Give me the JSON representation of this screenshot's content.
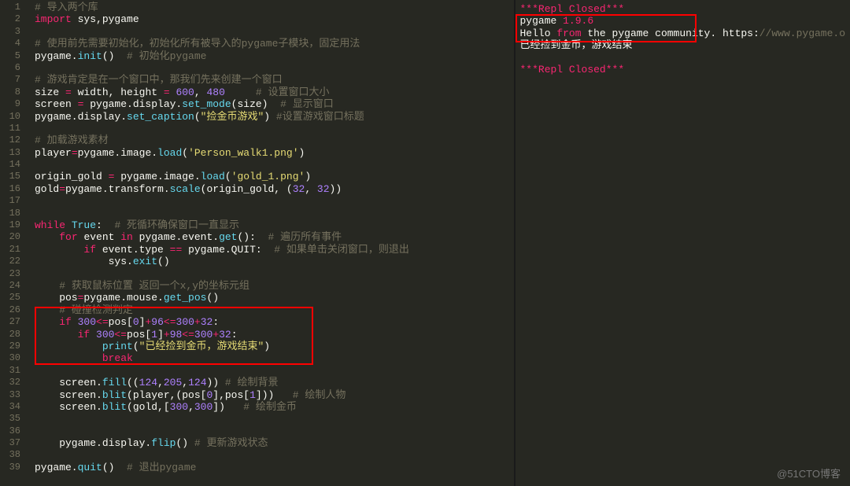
{
  "editor": {
    "lineStart": 1,
    "lineEnd": 39,
    "lines": [
      [
        {
          "t": "# 导入两个库",
          "cls": "c"
        }
      ],
      [
        {
          "t": "import ",
          "cls": "kw"
        },
        {
          "t": "sys,pygame",
          "cls": "nm"
        }
      ],
      [],
      [
        {
          "t": "# 使用前先需要初始化，初始化所有被导入的pygame子模块，固定用法",
          "cls": "c"
        }
      ],
      [
        {
          "t": "pygame.",
          "cls": "nm"
        },
        {
          "t": "init",
          "cls": "fn"
        },
        {
          "t": "()  ",
          "cls": "nm"
        },
        {
          "t": "# 初始化pygame",
          "cls": "c"
        }
      ],
      [],
      [
        {
          "t": "# 游戏肯定是在一个窗口中，那我们先来创建一个窗口",
          "cls": "c"
        }
      ],
      [
        {
          "t": "size ",
          "cls": "nm"
        },
        {
          "t": "= ",
          "cls": "op"
        },
        {
          "t": "width, height ",
          "cls": "nm"
        },
        {
          "t": "= ",
          "cls": "op"
        },
        {
          "t": "600",
          "cls": "nu"
        },
        {
          "t": ", ",
          "cls": "nm"
        },
        {
          "t": "480",
          "cls": "nu"
        },
        {
          "t": "     ",
          "cls": "nm"
        },
        {
          "t": "# 设置窗口大小",
          "cls": "c"
        }
      ],
      [
        {
          "t": "screen ",
          "cls": "nm"
        },
        {
          "t": "= ",
          "cls": "op"
        },
        {
          "t": "pygame.display.",
          "cls": "nm"
        },
        {
          "t": "set_mode",
          "cls": "fn"
        },
        {
          "t": "(size)  ",
          "cls": "nm"
        },
        {
          "t": "# 显示窗口",
          "cls": "c"
        }
      ],
      [
        {
          "t": "pygame.display.",
          "cls": "nm"
        },
        {
          "t": "set_caption",
          "cls": "fn"
        },
        {
          "t": "(",
          "cls": "nm"
        },
        {
          "t": "\"捡金币游戏\"",
          "cls": "st"
        },
        {
          "t": ") ",
          "cls": "nm"
        },
        {
          "t": "#设置游戏窗口标题",
          "cls": "c"
        }
      ],
      [],
      [
        {
          "t": "# 加载游戏素材",
          "cls": "c"
        }
      ],
      [
        {
          "t": "player",
          "cls": "nm"
        },
        {
          "t": "=",
          "cls": "op"
        },
        {
          "t": "pygame.image.",
          "cls": "nm"
        },
        {
          "t": "load",
          "cls": "fn"
        },
        {
          "t": "(",
          "cls": "nm"
        },
        {
          "t": "'Person_walk1.png'",
          "cls": "st"
        },
        {
          "t": ")",
          "cls": "nm"
        }
      ],
      [],
      [
        {
          "t": "origin_gold ",
          "cls": "nm"
        },
        {
          "t": "= ",
          "cls": "op"
        },
        {
          "t": "pygame.image.",
          "cls": "nm"
        },
        {
          "t": "load",
          "cls": "fn"
        },
        {
          "t": "(",
          "cls": "nm"
        },
        {
          "t": "'gold_1.png'",
          "cls": "st"
        },
        {
          "t": ")",
          "cls": "nm"
        }
      ],
      [
        {
          "t": "gold",
          "cls": "nm"
        },
        {
          "t": "=",
          "cls": "op"
        },
        {
          "t": "pygame.transform.",
          "cls": "nm"
        },
        {
          "t": "scale",
          "cls": "fn"
        },
        {
          "t": "(origin_gold, (",
          "cls": "nm"
        },
        {
          "t": "32",
          "cls": "nu"
        },
        {
          "t": ", ",
          "cls": "nm"
        },
        {
          "t": "32",
          "cls": "nu"
        },
        {
          "t": "))",
          "cls": "nm"
        }
      ],
      [],
      [],
      [
        {
          "t": "while ",
          "cls": "kw"
        },
        {
          "t": "True",
          "cls": "bi"
        },
        {
          "t": ":  ",
          "cls": "nm"
        },
        {
          "t": "# 死循环确保窗口一直显示",
          "cls": "c"
        }
      ],
      [
        {
          "t": "    ",
          "cls": "nm"
        },
        {
          "t": "for ",
          "cls": "kw"
        },
        {
          "t": "event ",
          "cls": "nm"
        },
        {
          "t": "in ",
          "cls": "kw"
        },
        {
          "t": "pygame.event.",
          "cls": "nm"
        },
        {
          "t": "get",
          "cls": "fn"
        },
        {
          "t": "():  ",
          "cls": "nm"
        },
        {
          "t": "# 遍历所有事件",
          "cls": "c"
        }
      ],
      [
        {
          "t": "        ",
          "cls": "nm"
        },
        {
          "t": "if ",
          "cls": "kw"
        },
        {
          "t": "event.type ",
          "cls": "nm"
        },
        {
          "t": "== ",
          "cls": "op"
        },
        {
          "t": "pygame.QUIT:  ",
          "cls": "nm"
        },
        {
          "t": "# 如果单击关闭窗口，则退出",
          "cls": "c"
        }
      ],
      [
        {
          "t": "            sys.",
          "cls": "nm"
        },
        {
          "t": "exit",
          "cls": "fn"
        },
        {
          "t": "()",
          "cls": "nm"
        }
      ],
      [],
      [
        {
          "t": "    ",
          "cls": "nm"
        },
        {
          "t": "# 获取鼠标位置 返回一个x,y的坐标元组",
          "cls": "c"
        }
      ],
      [
        {
          "t": "    pos",
          "cls": "nm"
        },
        {
          "t": "=",
          "cls": "op"
        },
        {
          "t": "pygame.mouse.",
          "cls": "nm"
        },
        {
          "t": "get_pos",
          "cls": "fn"
        },
        {
          "t": "()",
          "cls": "nm"
        }
      ],
      [
        {
          "t": "    ",
          "cls": "nm"
        },
        {
          "t": "# 碰撞检测判定",
          "cls": "c"
        }
      ],
      [
        {
          "t": "    ",
          "cls": "nm"
        },
        {
          "t": "if ",
          "cls": "kw"
        },
        {
          "t": "300",
          "cls": "nu"
        },
        {
          "t": "<=",
          "cls": "op"
        },
        {
          "t": "pos[",
          "cls": "nm"
        },
        {
          "t": "0",
          "cls": "nu"
        },
        {
          "t": "]",
          "cls": "nm"
        },
        {
          "t": "+",
          "cls": "op"
        },
        {
          "t": "96",
          "cls": "nu"
        },
        {
          "t": "<=",
          "cls": "op"
        },
        {
          "t": "300",
          "cls": "nu"
        },
        {
          "t": "+",
          "cls": "op"
        },
        {
          "t": "32",
          "cls": "nu"
        },
        {
          "t": ":",
          "cls": "nm"
        }
      ],
      [
        {
          "t": "       ",
          "cls": "nm"
        },
        {
          "t": "if ",
          "cls": "kw"
        },
        {
          "t": "300",
          "cls": "nu"
        },
        {
          "t": "<=",
          "cls": "op"
        },
        {
          "t": "pos[",
          "cls": "nm"
        },
        {
          "t": "1",
          "cls": "nu"
        },
        {
          "t": "]",
          "cls": "nm"
        },
        {
          "t": "+",
          "cls": "op"
        },
        {
          "t": "98",
          "cls": "nu"
        },
        {
          "t": "<=",
          "cls": "op"
        },
        {
          "t": "300",
          "cls": "nu"
        },
        {
          "t": "+",
          "cls": "op"
        },
        {
          "t": "32",
          "cls": "nu"
        },
        {
          "t": ":",
          "cls": "nm"
        }
      ],
      [
        {
          "t": "           ",
          "cls": "nm"
        },
        {
          "t": "print",
          "cls": "fn"
        },
        {
          "t": "(",
          "cls": "nm"
        },
        {
          "t": "\"已经捡到金币，游戏结束\"",
          "cls": "st"
        },
        {
          "t": ")",
          "cls": "nm"
        }
      ],
      [
        {
          "t": "           ",
          "cls": "nm"
        },
        {
          "t": "break",
          "cls": "kw"
        }
      ],
      [],
      [
        {
          "t": "    screen.",
          "cls": "nm"
        },
        {
          "t": "fill",
          "cls": "fn"
        },
        {
          "t": "((",
          "cls": "nm"
        },
        {
          "t": "124",
          "cls": "nu"
        },
        {
          "t": ",",
          "cls": "nm"
        },
        {
          "t": "205",
          "cls": "nu"
        },
        {
          "t": ",",
          "cls": "nm"
        },
        {
          "t": "124",
          "cls": "nu"
        },
        {
          "t": ")) ",
          "cls": "nm"
        },
        {
          "t": "# 绘制背景",
          "cls": "c"
        }
      ],
      [
        {
          "t": "    screen.",
          "cls": "nm"
        },
        {
          "t": "blit",
          "cls": "fn"
        },
        {
          "t": "(player,(pos[",
          "cls": "nm"
        },
        {
          "t": "0",
          "cls": "nu"
        },
        {
          "t": "],pos[",
          "cls": "nm"
        },
        {
          "t": "1",
          "cls": "nu"
        },
        {
          "t": "]))   ",
          "cls": "nm"
        },
        {
          "t": "# 绘制人物",
          "cls": "c"
        }
      ],
      [
        {
          "t": "    screen.",
          "cls": "nm"
        },
        {
          "t": "blit",
          "cls": "fn"
        },
        {
          "t": "(gold,[",
          "cls": "nm"
        },
        {
          "t": "300",
          "cls": "nu"
        },
        {
          "t": ",",
          "cls": "nm"
        },
        {
          "t": "300",
          "cls": "nu"
        },
        {
          "t": "])   ",
          "cls": "nm"
        },
        {
          "t": "# 绘制金币",
          "cls": "c"
        }
      ],
      [],
      [],
      [
        {
          "t": "    pygame.display.",
          "cls": "nm"
        },
        {
          "t": "flip",
          "cls": "fn"
        },
        {
          "t": "() ",
          "cls": "nm"
        },
        {
          "t": "# 更新游戏状态",
          "cls": "c"
        }
      ],
      [],
      [
        {
          "t": "pygame.",
          "cls": "nm"
        },
        {
          "t": "quit",
          "cls": "fn"
        },
        {
          "t": "()  ",
          "cls": "nm"
        },
        {
          "t": "# 退出pygame",
          "cls": "c"
        }
      ]
    ]
  },
  "output": {
    "lines": [
      [
        {
          "t": "***Repl Closed***",
          "cls": "magenta"
        }
      ],
      [
        {
          "t": "pygame ",
          "cls": "nm"
        },
        {
          "t": "1.9.6",
          "cls": "magenta"
        }
      ],
      [
        {
          "t": "Hello ",
          "cls": "nm"
        },
        {
          "t": "from",
          "cls": "magenta"
        },
        {
          "t": " the pygame community. https:",
          "cls": "nm"
        },
        {
          "t": "//www.pygame.o",
          "cls": "c"
        }
      ],
      [
        {
          "t": "已经捡到金币，游戏结束",
          "cls": "nm"
        }
      ],
      [],
      [
        {
          "t": "***Repl Closed***",
          "cls": "magenta"
        }
      ]
    ]
  },
  "watermark": "@51CTO博客"
}
